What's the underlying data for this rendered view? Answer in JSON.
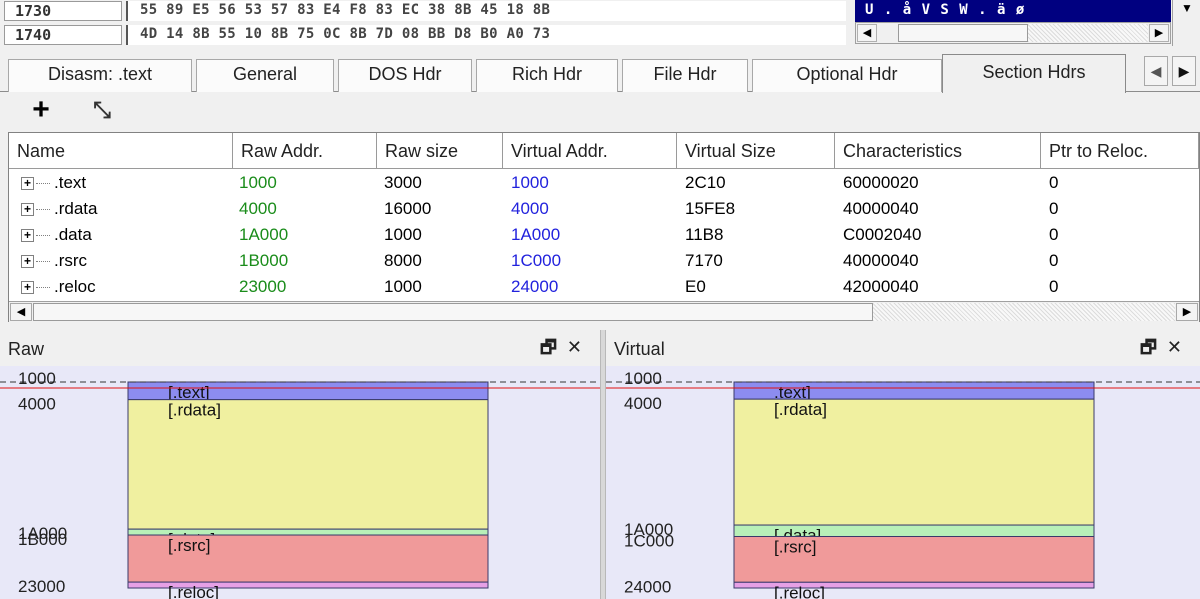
{
  "hex": {
    "rows": [
      {
        "address": "1730",
        "bytes": "55 89 E5 56 53 57 83 E4 F8 83 EC 38 8B 45 18 8B",
        "ascii": "U . å V S W . ä ø"
      },
      {
        "address": "1740",
        "bytes": "4D 14 8B 55 10 8B 75 0C 8B 7D 08 BB D8 B0 A0 73",
        "ascii": ""
      }
    ]
  },
  "tabs": [
    {
      "label": "Disasm: .text"
    },
    {
      "label": "General"
    },
    {
      "label": "DOS Hdr"
    },
    {
      "label": "Rich Hdr"
    },
    {
      "label": "File Hdr"
    },
    {
      "label": "Optional Hdr"
    },
    {
      "label": "Section Hdrs",
      "active": true
    }
  ],
  "toolbar": {
    "add_icon": "plus-icon",
    "fit_icon": "fit-to-window-icon"
  },
  "table": {
    "columns": [
      "Name",
      "Raw Addr.",
      "Raw size",
      "Virtual Addr.",
      "Virtual Size",
      "Characteristics",
      "Ptr to Reloc."
    ],
    "rows": [
      {
        "name": ".text",
        "raw_addr": "1000",
        "raw_size": "3000",
        "virtual_addr": "1000",
        "virtual_size": "2C10",
        "characteristics": "60000020",
        "ptr_reloc": "0"
      },
      {
        "name": ".rdata",
        "raw_addr": "4000",
        "raw_size": "16000",
        "virtual_addr": "4000",
        "virtual_size": "15FE8",
        "characteristics": "40000040",
        "ptr_reloc": "0"
      },
      {
        "name": ".data",
        "raw_addr": "1A000",
        "raw_size": "1000",
        "virtual_addr": "1A000",
        "virtual_size": "11B8",
        "characteristics": "C0002040",
        "ptr_reloc": "0"
      },
      {
        "name": ".rsrc",
        "raw_addr": "1B000",
        "raw_size": "8000",
        "virtual_addr": "1C000",
        "virtual_size": "7170",
        "characteristics": "40000040",
        "ptr_reloc": "0"
      },
      {
        "name": ".reloc",
        "raw_addr": "23000",
        "raw_size": "1000",
        "virtual_addr": "24000",
        "virtual_size": "E0",
        "characteristics": "42000040",
        "ptr_reloc": "0"
      }
    ],
    "colors": {
      "raw_addr": "#1a8c1a",
      "virtual_addr": "#2222dd"
    }
  },
  "panels": {
    "raw": {
      "title": "Raw",
      "address_labels": [
        {
          "text": "1000",
          "value": 4096
        },
        {
          "text": "4000",
          "value": 16384
        },
        {
          "text": "1A000",
          "value": 106496
        },
        {
          "text": "1B000",
          "value": 110592
        },
        {
          "text": "23000",
          "value": 143360
        }
      ],
      "sections": [
        {
          "name": "[.text]",
          "start": 4096,
          "size": 12288,
          "color": "#8c8cf0"
        },
        {
          "name": "[.rdata]",
          "start": 16384,
          "size": 90112,
          "color": "#f0f0a0"
        },
        {
          "name": "[.data]",
          "start": 106496,
          "size": 4096,
          "color": "#b8f0b8"
        },
        {
          "name": "[.rsrc]",
          "start": 110592,
          "size": 32768,
          "color": "#f09a9a"
        },
        {
          "name": "[.reloc]",
          "start": 143360,
          "size": 4096,
          "color": "#e6a0e6"
        }
      ],
      "range": [
        0,
        147456
      ]
    },
    "virtual": {
      "title": "Virtual",
      "address_labels": [
        {
          "text": "1000",
          "value": 4096
        },
        {
          "text": "4000",
          "value": 16384
        },
        {
          "text": "1A000",
          "value": 106496
        },
        {
          "text": "1C000",
          "value": 114688
        },
        {
          "text": "24000",
          "value": 147456
        }
      ],
      "sections": [
        {
          "name": ".text]",
          "start": 4096,
          "size": 12288,
          "color": "#8c8cf0"
        },
        {
          "name": "[.rdata]",
          "start": 16384,
          "size": 90112,
          "color": "#f0f0a0"
        },
        {
          "name": "[.data]",
          "start": 106496,
          "size": 8192,
          "color": "#b8f0b8"
        },
        {
          "name": "[.rsrc]",
          "start": 114688,
          "size": 32768,
          "color": "#f09a9a"
        },
        {
          "name": "[.reloc]",
          "start": 147456,
          "size": 4096,
          "color": "#e6a0e6"
        }
      ],
      "range": [
        0,
        151552
      ]
    },
    "controls": {
      "restore_icon": "restore-window-icon",
      "close_icon": "close-icon"
    }
  }
}
